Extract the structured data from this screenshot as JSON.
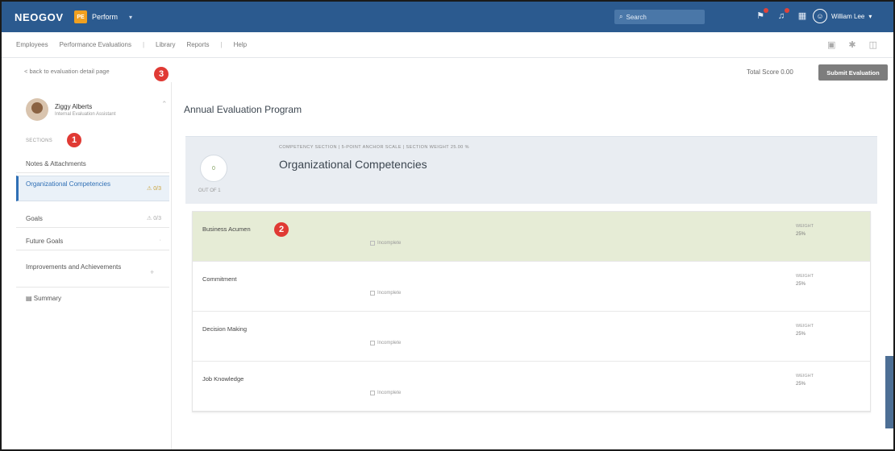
{
  "brand": "NEOGOV",
  "product": {
    "badge": "PE",
    "name": "Perform"
  },
  "search": {
    "label": "Search"
  },
  "user": {
    "name": "William Lee"
  },
  "nav": {
    "items": [
      {
        "label": "Employees"
      },
      {
        "label": "Performance Evaluations"
      },
      {
        "label": "Library"
      },
      {
        "label": "Reports"
      },
      {
        "label": "Help"
      }
    ]
  },
  "toolbar": {
    "back_link": "< back to evaluation detail page",
    "total_score": "Total Score 0.00",
    "submit_label": "Submit Evaluation"
  },
  "sidebar": {
    "employee_name": "Ziggy Alberts",
    "employee_sub": "Internal Evaluation Assistant",
    "sections_label": "SECTIONS",
    "items": [
      {
        "label": "Notes & Attachments",
        "extra": ""
      },
      {
        "label": "Organizational Competencies",
        "extra": "0/3"
      },
      {
        "label": "Goals",
        "extra": "0/3"
      },
      {
        "label": "Future Goals",
        "extra": ""
      },
      {
        "label": "Improvements and Achievements",
        "extra": ""
      },
      {
        "label": "Summary",
        "extra": ""
      }
    ]
  },
  "main": {
    "title": "Annual Evaluation Program",
    "section_meta": "COMPETENCY SECTION | 5-POINT ANCHOR SCALE | SECTION WEIGHT 25.00 %",
    "section_title": "Organizational Competencies",
    "section_circle": "0",
    "section_circle_label": "OUT OF 1",
    "competencies": [
      {
        "name": "Business Acumen",
        "status": "Incomplete",
        "weight_label": "WEIGHT",
        "weight": "25%"
      },
      {
        "name": "Commitment",
        "status": "Incomplete",
        "weight_label": "WEIGHT",
        "weight": "25%"
      },
      {
        "name": "Decision Making",
        "status": "Incomplete",
        "weight_label": "WEIGHT",
        "weight": "25%"
      },
      {
        "name": "Job Knowledge",
        "status": "Incomplete",
        "weight_label": "WEIGHT",
        "weight": "25%"
      }
    ]
  },
  "markers": {
    "m1": "1",
    "m2": "2",
    "m3": "3"
  },
  "colors": {
    "topbar": "#2b5a8f",
    "accent": "#2f6fb5",
    "highlight_row": "#e6ecd6",
    "marker": "#e03a34"
  }
}
